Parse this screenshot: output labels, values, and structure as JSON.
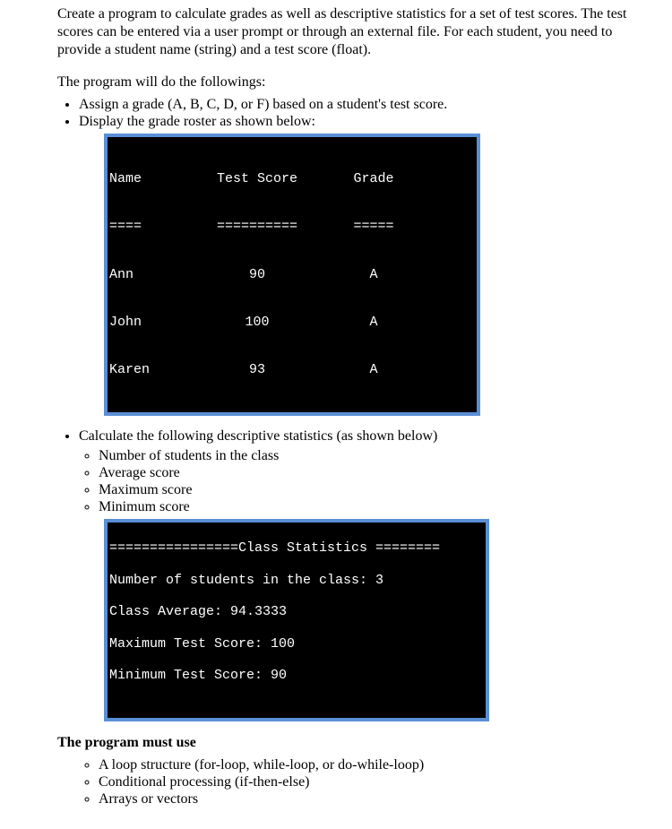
{
  "intro1": "Create a program to calculate grades as well as descriptive statistics for a set of test scores.   The test scores can be entered via a user prompt or through an external file.  For each student, you need to provide a student name (string) and a test score (float).",
  "intro2": "The program will do the followings:",
  "bullets_top": [
    "Assign a grade (A, B, C, D, or F) based on a student's test score.",
    "Display the grade roster as shown below:"
  ],
  "roster": {
    "header": {
      "name": "Name",
      "score": "Test Score",
      "grade": "Grade"
    },
    "sep": {
      "name": "====",
      "score": "==========",
      "grade": "====="
    },
    "rows": [
      {
        "name": "Ann",
        "score": "90",
        "grade": "A"
      },
      {
        "name": "John",
        "score": "100",
        "grade": "A"
      },
      {
        "name": "Karen",
        "score": "93",
        "grade": "A"
      }
    ]
  },
  "bullet_calc": "Calculate the following descriptive statistics (as shown below)",
  "sub_calc": [
    "Number of students in the class",
    "Average score",
    "Maximum score",
    "Minimum score"
  ],
  "stats_lines": [
    "================Class Statistics ========",
    "Number of students in the class: 3",
    "Class Average: 94.3333",
    "Maximum Test Score: 100",
    "Minimum Test Score: 90"
  ],
  "mustuse_heading": "The program must use",
  "mustuse_items": [
    "A loop structure (for-loop, while-loop, or do-while-loop)",
    "Conditional processing (if-then-else)",
    "Arrays or vectors"
  ],
  "chart_data": {
    "type": "table",
    "title": "Grade Roster",
    "columns": [
      "Name",
      "Test Score",
      "Grade"
    ],
    "rows": [
      [
        "Ann",
        90,
        "A"
      ],
      [
        "John",
        100,
        "A"
      ],
      [
        "Karen",
        93,
        "A"
      ]
    ],
    "statistics": {
      "count": 3,
      "average": 94.3333,
      "max": 100,
      "min": 90
    }
  }
}
